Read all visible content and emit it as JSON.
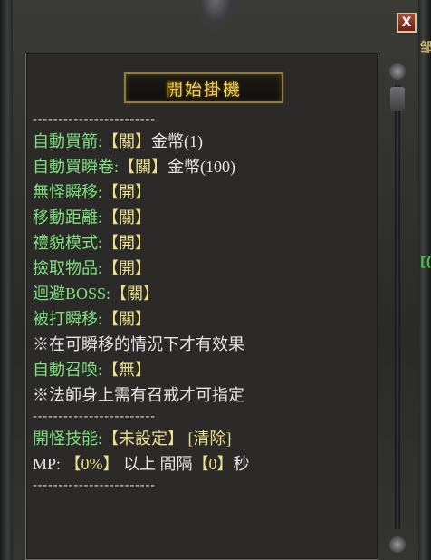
{
  "window": {
    "title_button": "開始掛機",
    "close_label": "X",
    "side_glyph_top": "邹",
    "side_glyph_mid": "[("
  },
  "separator": "------------------------",
  "settings": {
    "auto_buy_arrows": {
      "label": "自動買箭:",
      "value": "【關】",
      "cost": "金幣(1)"
    },
    "auto_buy_teleport": {
      "label": "自動買瞬卷:",
      "value": "【關】",
      "cost": "金幣(100)"
    },
    "no_monster_teleport": {
      "label": "無怪瞬移:",
      "value": "【開】"
    },
    "move_distance": {
      "label": "移動距離:",
      "value": "【關】"
    },
    "courtesy_mode": {
      "label": "禮貌模式:",
      "value": "【開】"
    },
    "pickup_items": {
      "label": "撿取物品:",
      "value": "【開】"
    },
    "avoid_boss": {
      "label": "迴避BOSS:",
      "value": "【關】"
    },
    "hit_teleport": {
      "label": "被打瞬移:",
      "value": "【關】"
    },
    "teleport_note": "※在可瞬移的情況下才有效果",
    "auto_summon": {
      "label": "自動召喚:",
      "value": "【無】"
    },
    "summon_note": "※法師身上需有召戒才可指定"
  },
  "skill": {
    "label": "開怪技能:",
    "value": "【未設定】",
    "clear": "[清除]"
  },
  "mp": {
    "label": "MP:",
    "percent": "【0%】",
    "above": "以上",
    "interval_label": "間隔",
    "interval": "【0】",
    "unit": "秒"
  }
}
